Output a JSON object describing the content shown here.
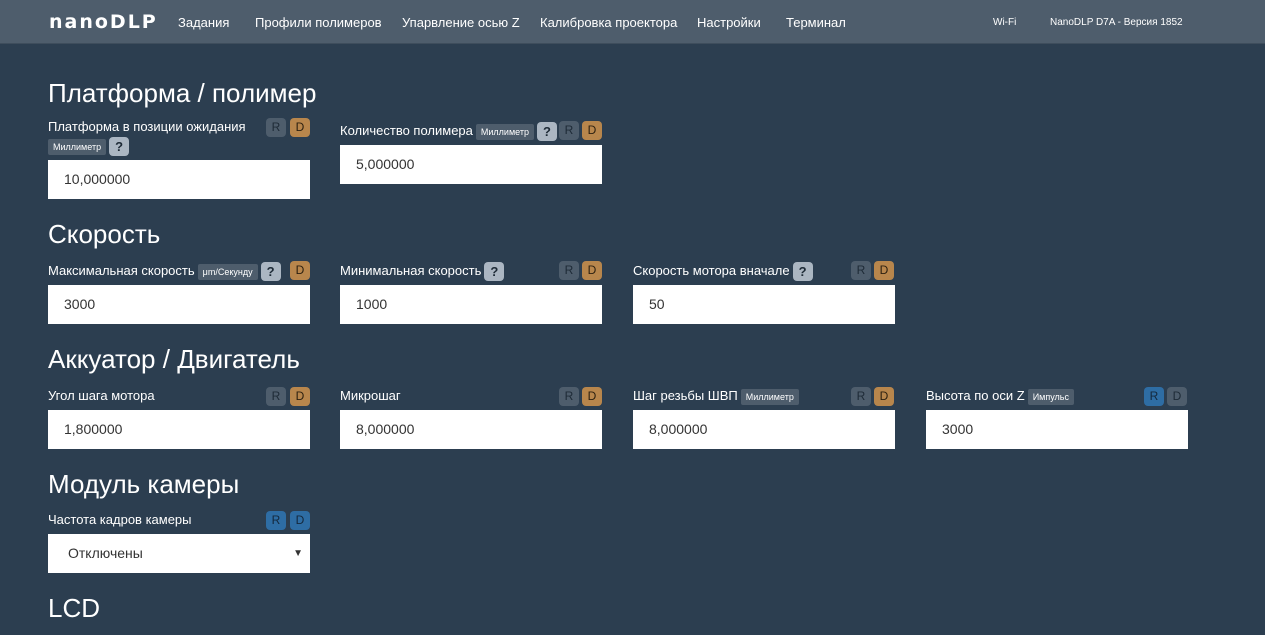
{
  "nav": {
    "brand": "nanoDLP",
    "items": [
      "Задания",
      "Профили полимеров",
      "Упарвление осью Z",
      "Калибровка проектора",
      "Настройки",
      "Терминал"
    ],
    "wifi": "Wi-Fi",
    "version": "NanoDLP D7A - Версия 1852"
  },
  "sections": {
    "platform": "Платформа / полимер",
    "speed": "Скорость",
    "actuator": "Аккуатор / Двигатель",
    "camera": "Модуль камеры",
    "lcd": "LCD"
  },
  "buttons": {
    "r": "R",
    "d": "D",
    "help": "?"
  },
  "fields": {
    "wait_height": {
      "label": "Платформа в позиции ожидания",
      "unit": "Миллиметр",
      "value": "10,000000"
    },
    "resin_amount": {
      "label": "Количество полимера",
      "unit": "Миллиметр",
      "value": "5,000000"
    },
    "max_speed": {
      "label": "Максимальная скорость",
      "unit": "μm/Секунду",
      "value": "3000"
    },
    "min_speed": {
      "label": "Минимальная скорость",
      "value": "1000"
    },
    "start_speed": {
      "label": "Скорость мотора вначале",
      "value": "50"
    },
    "step_angle": {
      "label": "Угол шага мотора",
      "value": "1,800000"
    },
    "microstep": {
      "label": "Микрошаг",
      "value": "8,000000"
    },
    "leadscrew_pitch": {
      "label": "Шаг резьбы ШВП",
      "unit": "Миллиметр",
      "value": "8,000000"
    },
    "z_height": {
      "label": "Высота по оси Z",
      "unit": "Импульс",
      "value": "3000"
    },
    "camera_fps": {
      "label": "Частота кадров камеры",
      "value": "Отключены"
    }
  },
  "colors": {
    "background": "#2c3e50",
    "navbar": "#4e5d6c",
    "d_button": "#b8864c",
    "r_active": "#2e6da4"
  }
}
